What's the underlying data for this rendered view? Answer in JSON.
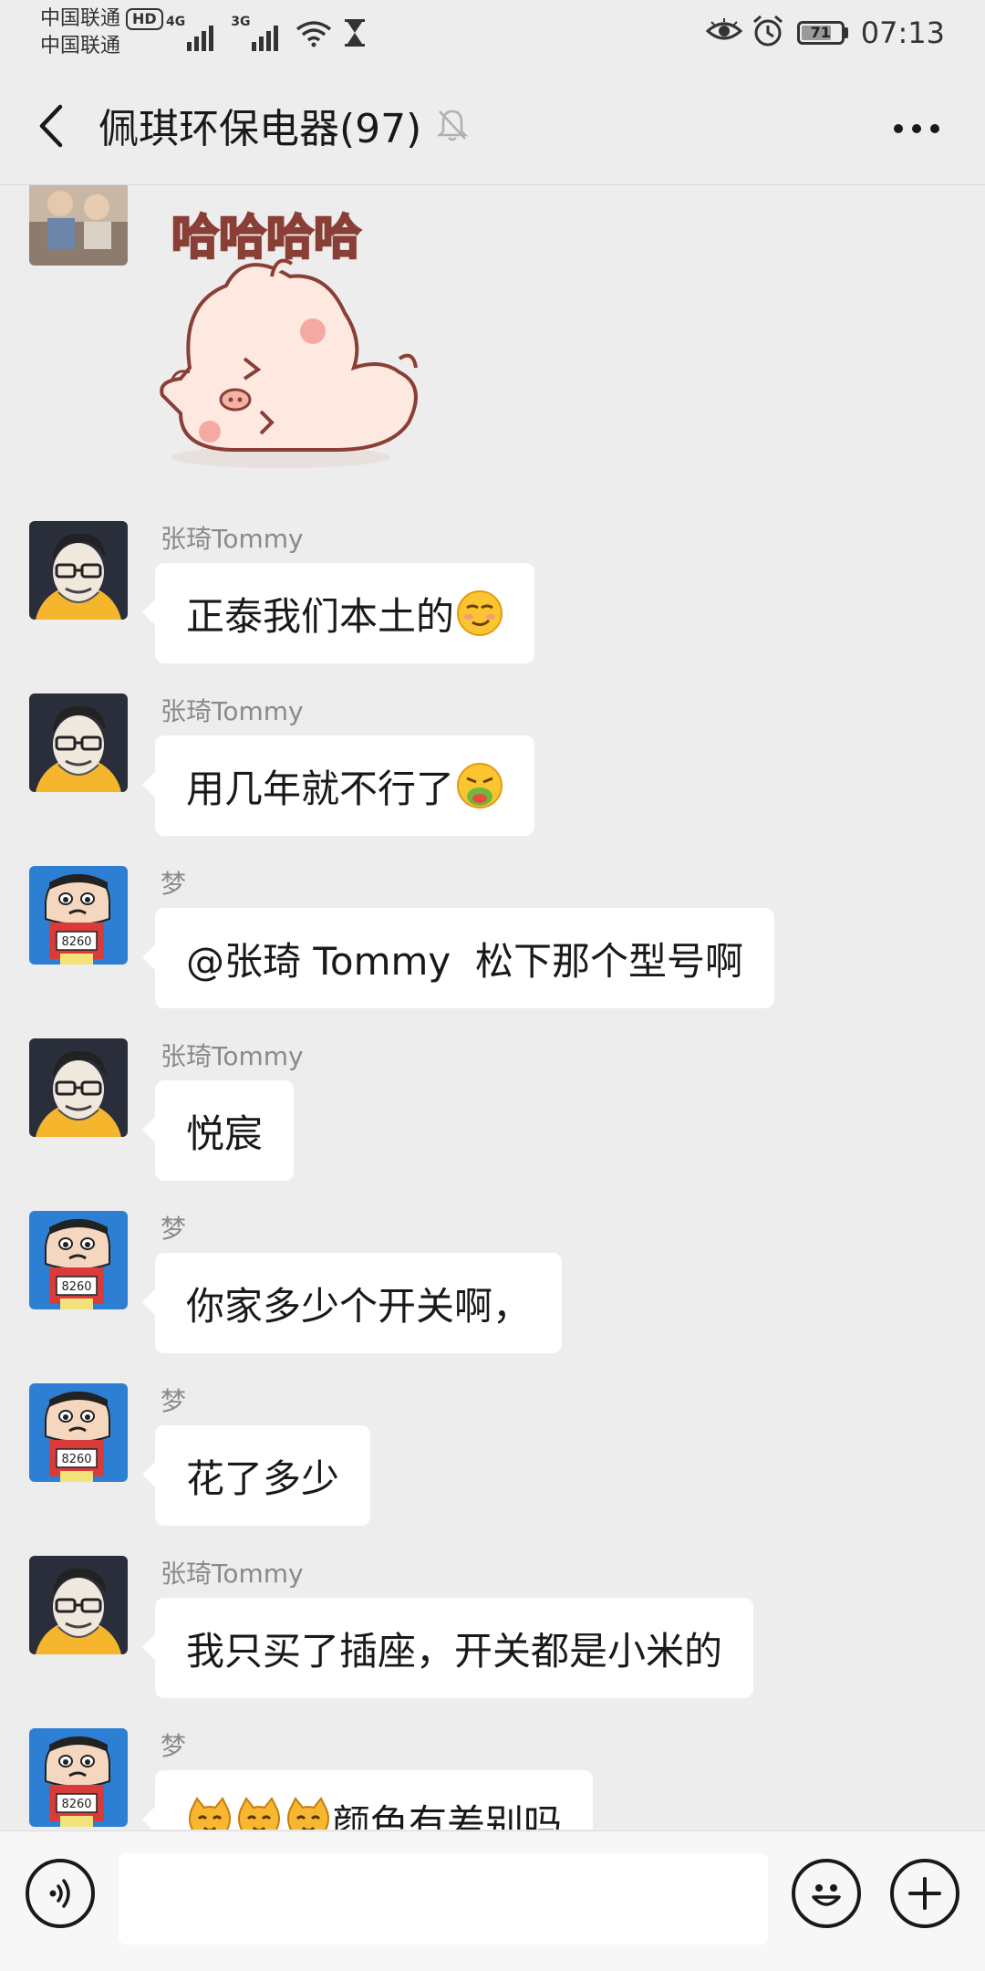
{
  "status_bar": {
    "carrier_1": "中国联通",
    "carrier_2": "中国联通",
    "hd_badge": "HD",
    "net_1": "4G",
    "net_2": "3G",
    "battery_level": "71",
    "time": "07:13"
  },
  "header": {
    "title": "佩琪环保电器(97)"
  },
  "sticker": {
    "caption": "哈哈哈哈"
  },
  "messages": [
    {
      "sender": "张琦Tommy",
      "text": "正泰我们本土的",
      "emoji": "smirk-emoji"
    },
    {
      "sender": "张琦Tommy",
      "text": "用几年就不行了",
      "emoji": "vomit-emoji"
    },
    {
      "sender": "梦",
      "text": "@张琦 Tommy  松下那个型号啊"
    },
    {
      "sender": "张琦Tommy",
      "text": "悦宸"
    },
    {
      "sender": "梦",
      "text": "你家多少个开关啊，"
    },
    {
      "sender": "梦",
      "text": "花了多少"
    },
    {
      "sender": "张琦Tommy",
      "text": "我只买了插座，开关都是小米的"
    },
    {
      "sender": "梦",
      "text": "颜色有差别吗",
      "emoji": "cat-emoji"
    }
  ],
  "input": {
    "placeholder": ""
  },
  "colors": {
    "background": "#ededed",
    "bubble": "#ffffff",
    "sender_text": "#8a8a8a"
  }
}
